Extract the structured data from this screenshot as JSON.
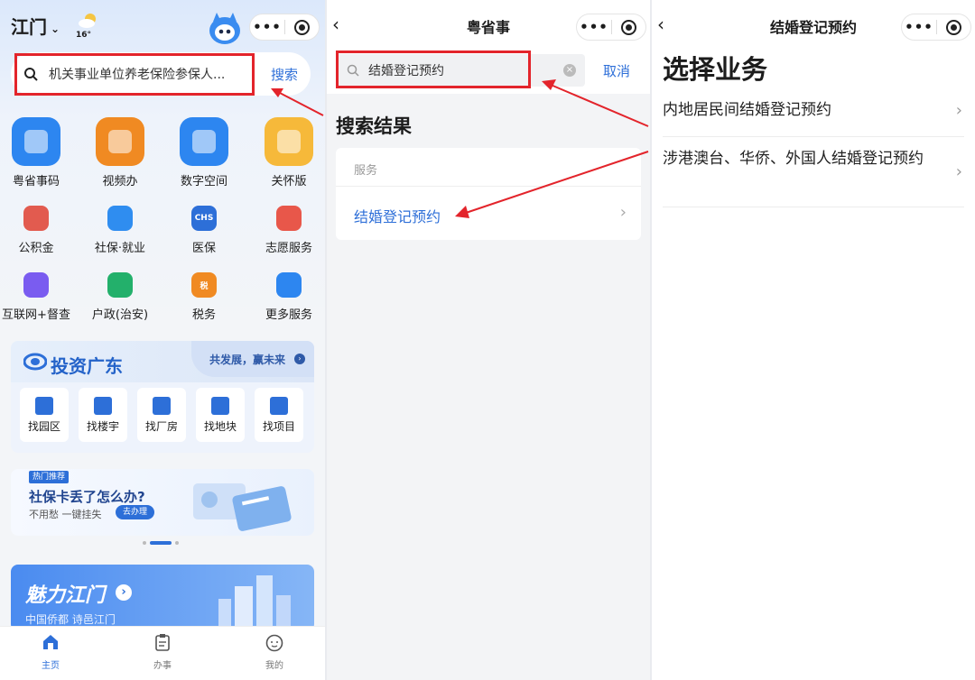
{
  "panel1": {
    "city": "江门",
    "weather_temp": "16°",
    "search_text": "机关事业单位养老保险参保人...",
    "search_button": "搜索",
    "services": [
      {
        "label": "粤省事码",
        "icon": "qr-code-icon",
        "color": "#2d86f0"
      },
      {
        "label": "视频办",
        "icon": "video-icon",
        "color": "#f08a22"
      },
      {
        "label": "数字空间",
        "icon": "folder-icon",
        "color": "#2d86f0"
      },
      {
        "label": "关怀版",
        "icon": "care-icon",
        "color": "#f6b93a"
      }
    ],
    "services_small": [
      {
        "label": "公积金",
        "icon": "house-fund-icon",
        "color": "#e25b4f"
      },
      {
        "label": "社保·就业",
        "icon": "social-security-icon",
        "color": "#2f8df0"
      },
      {
        "label": "医保",
        "icon": "medical-insurance-icon",
        "color": "#2d6fd8",
        "text": "CHS"
      },
      {
        "label": "志愿服务",
        "icon": "volunteer-icon",
        "color": "#e8574a"
      },
      {
        "label": "互联网+督查",
        "icon": "inspection-icon",
        "color": "#7a5cf0"
      },
      {
        "label": "户政(治安)",
        "icon": "household-icon",
        "color": "#23b06b"
      },
      {
        "label": "税务",
        "icon": "tax-icon",
        "color": "#f08a22",
        "text": "税"
      },
      {
        "label": "更多服务",
        "icon": "more-services-icon",
        "color": "#2d86f0"
      }
    ],
    "invest": {
      "title": "投资广东",
      "slogan": "共发展，赢未来",
      "items": [
        "找园区",
        "找楼宇",
        "找厂房",
        "找地块",
        "找项目"
      ]
    },
    "banner": {
      "tag": "热门推荐",
      "title": "社保卡丢了怎么办?",
      "subtitle": "不用愁 一键挂失",
      "button": "去办理"
    },
    "charm": {
      "title": "魅力江门",
      "subtitle": "中国侨都 诗邑江门"
    },
    "tabs": [
      "主页",
      "办事",
      "我的"
    ]
  },
  "panel2": {
    "title": "粤省事",
    "search_value": "结婚登记预约",
    "cancel": "取消",
    "results_heading": "搜索结果",
    "section_label": "服务",
    "result_item": "结婚登记预约"
  },
  "panel3": {
    "title": "结婚登记预约",
    "heading": "选择业务",
    "options": [
      "内地居民间结婚登记预约",
      "涉港澳台、华侨、外国人结婚登记预约"
    ]
  }
}
